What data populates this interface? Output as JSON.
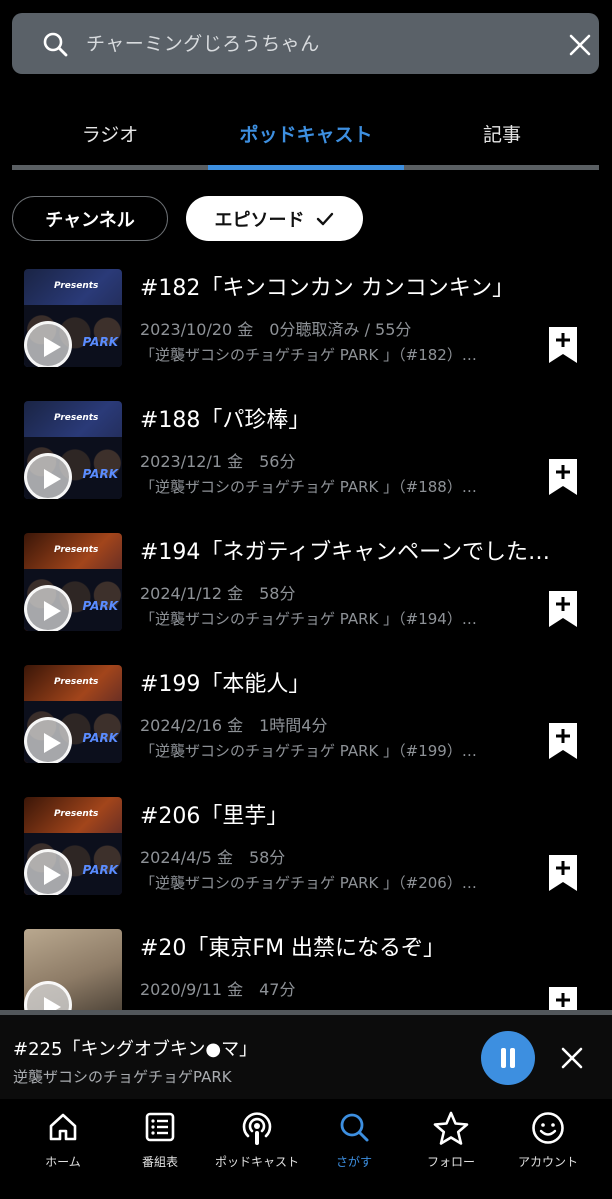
{
  "search": {
    "query": "チャーミングじろうちゃん"
  },
  "tabs": [
    {
      "label": "ラジオ"
    },
    {
      "label": "ポッドキャスト"
    },
    {
      "label": "記事"
    }
  ],
  "filters": {
    "channel": "チャンネル",
    "episode": "エピソード"
  },
  "episodes": [
    {
      "title": "#182「キンコンカン カンコンキン」",
      "meta": "2023/10/20 金　0分聴取済み / 55分",
      "program": "「逆襲ザコシのチョゲチョゲ PARK 」（#182）…"
    },
    {
      "title": "#188「パ珍棒」",
      "meta": "2023/12/1 金　56分",
      "program": "「逆襲ザコシのチョゲチョゲ PARK 」（#188）…"
    },
    {
      "title": "#194「ネガティブキャンペーンでした…",
      "meta": "2024/1/12 金　58分",
      "program": "「逆襲ザコシのチョゲチョゲ PARK 」（#194）…"
    },
    {
      "title": "#199「本能人」",
      "meta": "2024/2/16 金　1時間4分",
      "program": "「逆襲ザコシのチョゲチョゲ PARK 」（#199）…"
    },
    {
      "title": "#206「里芋」",
      "meta": "2024/4/5 金　58分",
      "program": "「逆襲ザコシのチョゲチョゲ PARK 」（#206）…"
    },
    {
      "title": "#20「東京FM 出禁になるぞ」",
      "meta": "2020/9/11 金　47分",
      "program": ""
    }
  ],
  "player": {
    "title": "#225「キングオブキン●マ」",
    "subtitle": "逆襲ザコシのチョゲチョゲPARK"
  },
  "nav": [
    {
      "label": "ホーム",
      "icon": "home-icon"
    },
    {
      "label": "番組表",
      "icon": "list-icon"
    },
    {
      "label": "ポッドキャスト",
      "icon": "podcast-icon"
    },
    {
      "label": "さがす",
      "icon": "search-icon"
    },
    {
      "label": "フォロー",
      "icon": "star-icon"
    },
    {
      "label": "アカウント",
      "icon": "smile-icon"
    }
  ],
  "colors": {
    "accent": "#3d8fe0",
    "background": "#000000",
    "search_bg": "#5a6168"
  }
}
